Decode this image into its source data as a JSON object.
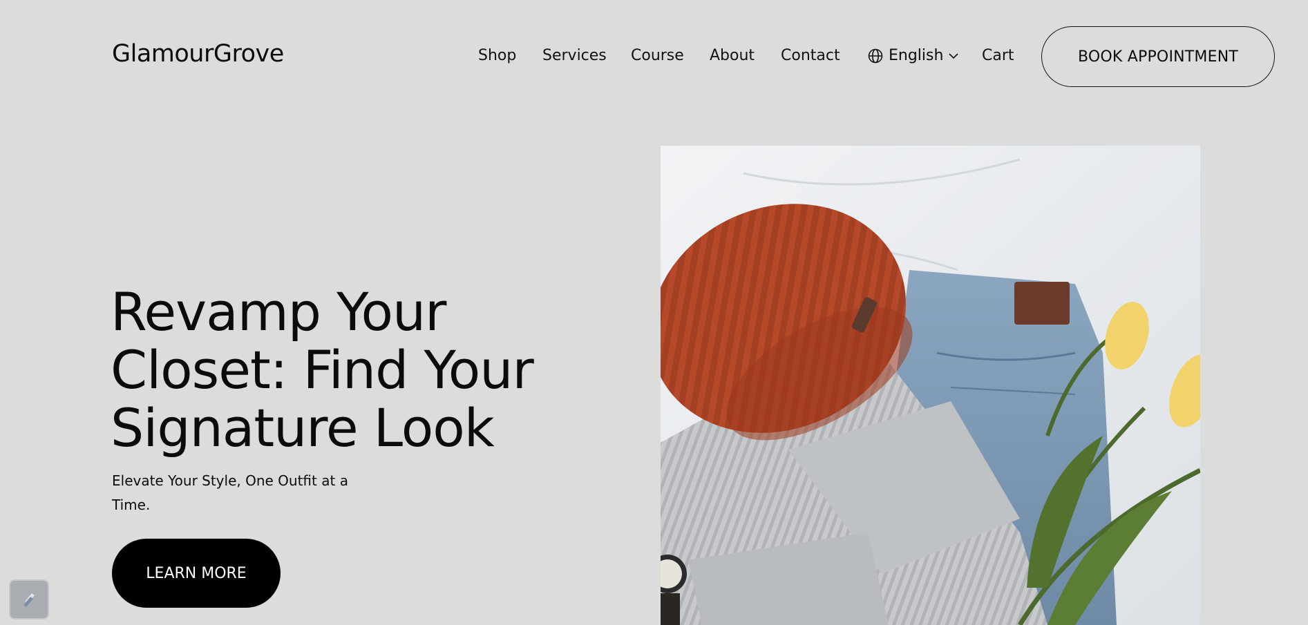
{
  "brand": {
    "name": "GlamourGrove"
  },
  "nav": {
    "items": [
      "Shop",
      "Services",
      "Course",
      "About",
      "Contact"
    ],
    "language": "English",
    "cart": "Cart",
    "cta": "BOOK APPOINTMENT"
  },
  "hero": {
    "title_lines": [
      "Revamp Your",
      "Closet: Find Your",
      "Signature Look"
    ],
    "subtitle": "Elevate Your Style, One Outfit at a Time.",
    "button": "LEARN MORE",
    "image_alt": "flat-lay of knit beanie, grey sweater, jeans and yellow tulips"
  },
  "colors": {
    "background": "#dcdcdc",
    "text": "#0b0b0b",
    "button_dark": "#000000",
    "beanie": "#b5492a",
    "denim": "#7d98b3",
    "tulip": "#f2d36b"
  },
  "icons": {
    "language": "globe-icon",
    "dropdown": "chevron-down-icon",
    "badge": "app-badge-icon"
  }
}
